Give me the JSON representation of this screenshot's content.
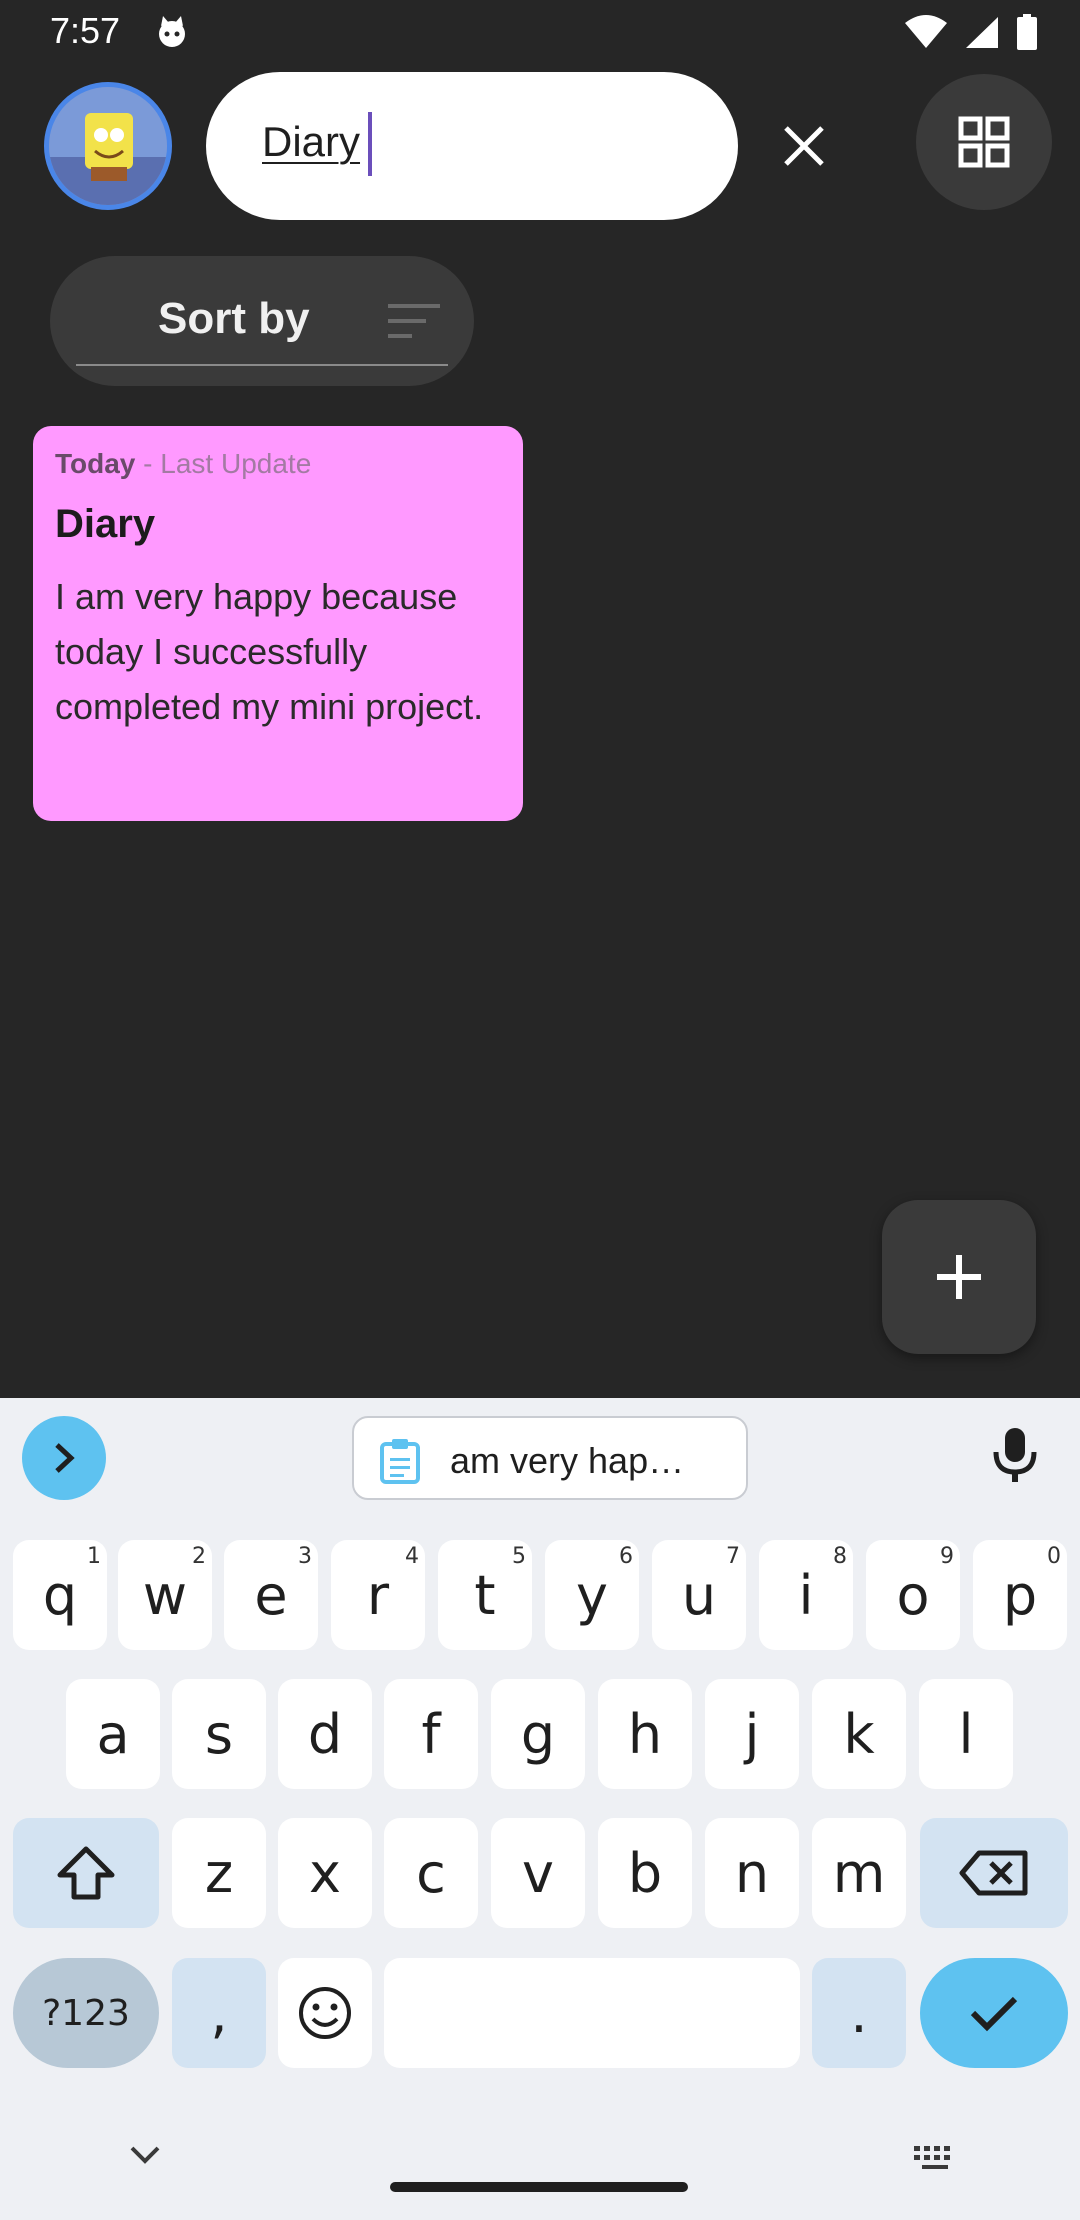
{
  "status_bar": {
    "time": "7:57",
    "icons": [
      "cat-notification-icon",
      "wifi-icon",
      "signal-icon",
      "battery-icon"
    ]
  },
  "header": {
    "search_value": "Diary",
    "clear_icon": "close-icon",
    "layout_icon": "grid-view-icon"
  },
  "sort": {
    "label": "Sort by",
    "icon": "sort-icon"
  },
  "notes": [
    {
      "date_label": "Today",
      "meta_label": " - Last Update",
      "title": "Diary",
      "body": "I am very happy because today I successfully completed my mini project.",
      "color": "#ff99ff"
    }
  ],
  "fab": {
    "icon": "add-icon"
  },
  "keyboard": {
    "clipboard_suggestion": "am very hap…",
    "row1": [
      {
        "k": "q",
        "h": "1"
      },
      {
        "k": "w",
        "h": "2"
      },
      {
        "k": "e",
        "h": "3"
      },
      {
        "k": "r",
        "h": "4"
      },
      {
        "k": "t",
        "h": "5"
      },
      {
        "k": "y",
        "h": "6"
      },
      {
        "k": "u",
        "h": "7"
      },
      {
        "k": "i",
        "h": "8"
      },
      {
        "k": "o",
        "h": "9"
      },
      {
        "k": "p",
        "h": "0"
      }
    ],
    "row2": [
      "a",
      "s",
      "d",
      "f",
      "g",
      "h",
      "j",
      "k",
      "l"
    ],
    "row3": [
      "z",
      "x",
      "c",
      "v",
      "b",
      "n",
      "m"
    ],
    "symbols_label": "?123",
    "comma": ",",
    "period": "."
  },
  "colors": {
    "background": "#262626",
    "accent_blue": "#5ec2f0",
    "note_pink": "#ff99ff"
  }
}
